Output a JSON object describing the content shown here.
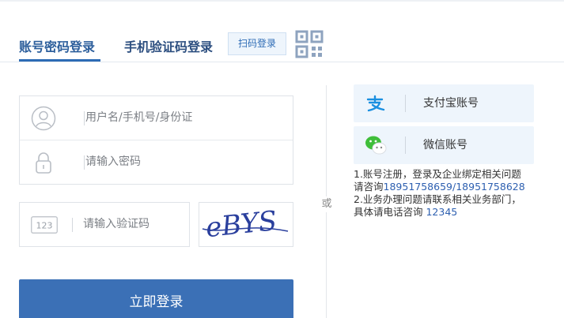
{
  "tabs": {
    "account_login": "账号密码登录",
    "sms_login": "手机验证码登录",
    "scan_login": "扫码登录"
  },
  "form": {
    "username_placeholder": "用户名/手机号/身份证",
    "password_placeholder": "请输入密码",
    "captcha_placeholder": "请输入验证码",
    "captcha_icon_text": "123",
    "captcha_image_text": "eBYS",
    "login_button": "立即登录"
  },
  "divider": {
    "or": "或"
  },
  "third_party": {
    "alipay_label": "支付宝账号",
    "wechat_label": "微信账号"
  },
  "notes": {
    "line1": "1.账号注册，登录及企业绑定相关问题",
    "line2_prefix": "请咨询",
    "line2_phone": "18951758659/18951758628",
    "line3": "2.业务办理问题请联系相关业务部门，",
    "line4_prefix": "具体请电话咨询 ",
    "line4_phone": "12345"
  },
  "colors": {
    "primary": "#3b70b6",
    "tab_active": "#2d5f9c",
    "link": "#2d5fb0",
    "third_party_bg": "#eef5fc"
  },
  "icons": {
    "username": "user-icon",
    "password": "lock-icon",
    "captcha": "captcha-icon",
    "qr": "qr-code-icon",
    "alipay": "alipay-icon",
    "wechat": "wechat-icon"
  }
}
